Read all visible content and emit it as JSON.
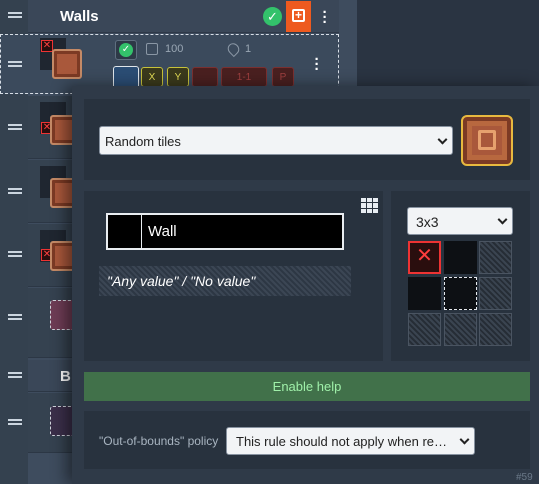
{
  "layers": {
    "walls_title": "Walls",
    "b_title": "B"
  },
  "selected_rule": {
    "chance": "100",
    "break_count": "1",
    "flip_x": "X",
    "flip_y": "Y",
    "offset": "1-1",
    "perlin": "P"
  },
  "popup": {
    "mode_select": "Random tiles",
    "value_name": "Wall",
    "any_value_text": "\"Any value\" / \"No value\"",
    "pattern_size": "3x3",
    "help_button": "Enable help",
    "oob_label": "\"Out-of-bounds\" policy",
    "oob_select": "This rule should not apply when re…"
  },
  "footer": {
    "rule_id": "#59"
  },
  "colors": {
    "accent_orange": "#ee5a1f",
    "active_green": "#33c26b",
    "help_green": "#41714a",
    "tile_brown": "#a9583b"
  },
  "icons": [
    "check-icon",
    "add-icon",
    "more-vertical-icon",
    "drag-handle-icon",
    "dice-icon",
    "drop-icon",
    "hand-icon",
    "grid-icon",
    "x-icon"
  ]
}
